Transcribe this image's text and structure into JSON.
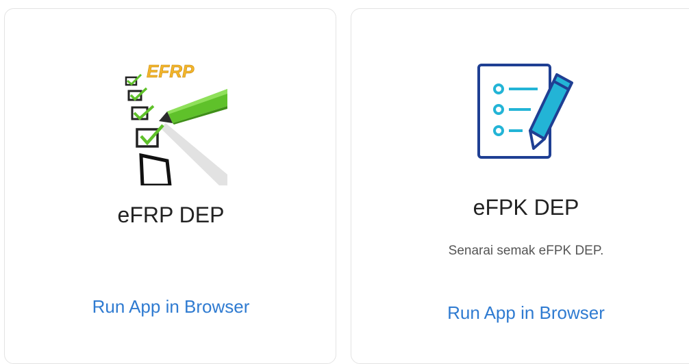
{
  "colors": {
    "link": "#2f7bd1",
    "title": "#222222",
    "description": "#555555",
    "card_border": "#e3e3e3",
    "icon_navy": "#1f3f93",
    "icon_teal": "#23b4d6",
    "efrp_gold": "#f2b52b",
    "efrp_green": "#5fc12a"
  },
  "apps": [
    {
      "title": "eFRP DEP",
      "description": "",
      "action_label": "Run App in Browser",
      "icon": "checklist-pencil-logo-icon",
      "logo_text": "EFRP"
    },
    {
      "title": "eFPK DEP",
      "description": "Senarai semak eFPK DEP.",
      "action_label": "Run App in Browser",
      "icon": "clipboard-list-pencil-icon"
    }
  ]
}
